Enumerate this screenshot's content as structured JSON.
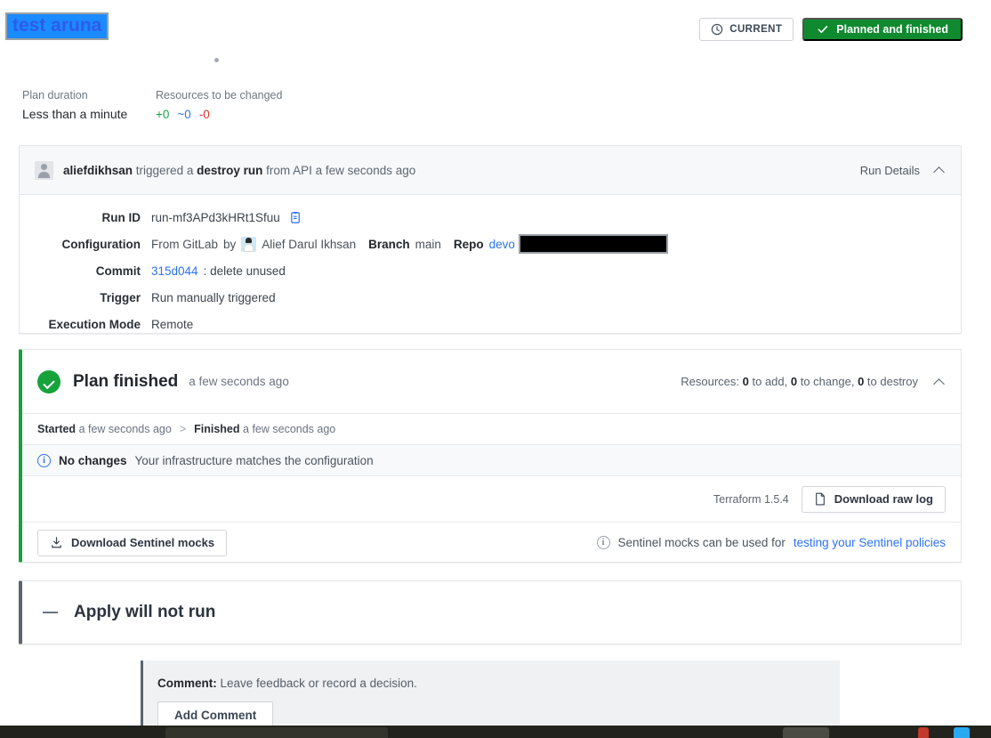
{
  "header": {
    "run_title": "test aruna",
    "current_button": "CURRENT",
    "current_icon": "clock-icon",
    "status_button": "Planned and finished",
    "status_icon": "check-icon",
    "status_color": "#0f8a2f"
  },
  "meta": {
    "duration_label": "Plan duration",
    "duration_value": "Less than a minute",
    "resources_label": "Resources to be changed",
    "add": "+0",
    "change": "~0",
    "destroy": "-0",
    "add_color": "#1aa34a",
    "change_color": "#2d72f6",
    "destroy_color": "#e03030"
  },
  "run_card": {
    "header": {
      "actor": "aliefdikhsan",
      "verb": "triggered a",
      "run_type": "destroy run",
      "source": "from API a few seconds ago",
      "toggle_label": "Run Details",
      "toggle_icon": "chevron-up-icon"
    },
    "rows": [
      {
        "key": "Run ID",
        "value": "run-mf3APd3kHRt1Sfuu",
        "icon": "copy-icon"
      },
      {
        "key": "Configuration",
        "value": "From GitLab",
        "by_label": "by",
        "author": "Alief Darul Ikhsan",
        "branch_label": "Branch",
        "branch": "main",
        "repo_label": "Repo",
        "repo": "devo",
        "repo_redacted": true
      },
      {
        "key": "Commit",
        "commit_sha": "315d044",
        "commit_msg": ": delete unused"
      },
      {
        "key": "Trigger",
        "value": "Run manually triggered"
      },
      {
        "key": "Execution Mode",
        "value": "Remote"
      }
    ]
  },
  "plan_card": {
    "title": "Plan finished",
    "subtitle": "a few seconds ago",
    "status_icon": "check-circle-icon",
    "resources_prefix": "Resources:",
    "resources_add": "0",
    "resources_add_suffix": " to add,",
    "resources_change": "0",
    "resources_change_suffix": " to change,",
    "resources_destroy": "0",
    "resources_destroy_suffix": " to destroy",
    "toggle_icon": "chevron-up-icon",
    "timeline": {
      "started_label": "Started",
      "started_value": "a few seconds ago",
      "separator": ">",
      "finished_label": "Finished",
      "finished_value": "a few seconds ago"
    },
    "notice": {
      "icon": "info-icon",
      "title": "No changes",
      "text": "Your infrastructure matches the configuration"
    },
    "terraform_version": "Terraform 1.5.4",
    "download_raw_log": "Download raw log",
    "download_raw_log_icon": "file-icon",
    "download_sentinel_mocks": "Download Sentinel mocks",
    "download_sentinel_mocks_icon": "download-icon",
    "sentinel_note_icon": "info-icon",
    "sentinel_note_text": "Sentinel mocks can be used for",
    "sentinel_note_link": "testing your Sentinel policies",
    "accent_color": "#14a33a"
  },
  "apply_card": {
    "title": "Apply will not run",
    "icon": "dash-icon",
    "accent_color": "#5c636e"
  },
  "comment_panel": {
    "label": "Comment:",
    "text": "Leave feedback or record a decision.",
    "button": "Add Comment"
  }
}
